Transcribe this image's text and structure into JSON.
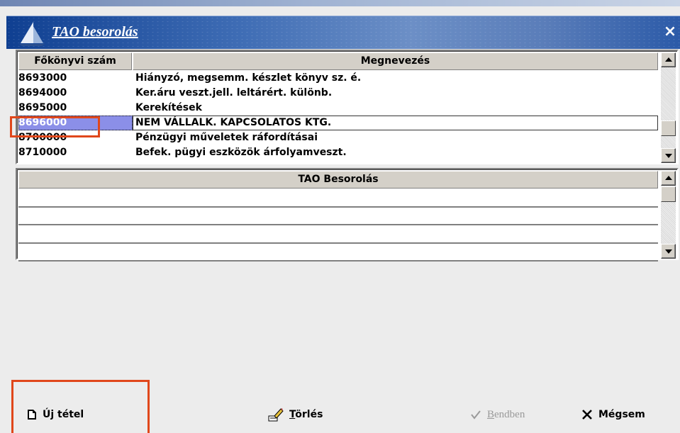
{
  "window": {
    "title": "TAO besorolás",
    "close_glyph": "×"
  },
  "grid_main": {
    "headers": [
      "Főkönyvi szám",
      "Megnevezés"
    ],
    "rows": [
      {
        "code": "8693000",
        "name": "Hiányzó, megsemm. készlet könyv sz. é."
      },
      {
        "code": "8694000",
        "name": "Ker.áru veszt.jell. leltárért. különb."
      },
      {
        "code": "8695000",
        "name": "Kerekítések"
      },
      {
        "code": "8696000",
        "name": "NEM VÁLLALK. KAPCSOLATOS KTG.",
        "selected": true
      },
      {
        "code": "8700000",
        "name": "Pénzügyi műveletek ráfordításai"
      },
      {
        "code": "8710000",
        "name": "Befek. pügyi eszközök árfolyamveszt."
      }
    ]
  },
  "grid_tao": {
    "header": "TAO Besorolás",
    "empty_rows": 4
  },
  "toolbar": {
    "new_label": "Új tétel",
    "delete_prefix": "T",
    "delete_rest": "örlés",
    "ok_prefix": "B",
    "ok_rest": "endben",
    "cancel_label": "Mégsem"
  },
  "colors": {
    "selection": "#8b8fe8",
    "highlight": "#e0471b",
    "titlebar": "#1f4fa0",
    "disabled": "#9a9a9a"
  },
  "icons": {
    "new": "document-icon",
    "delete": "pencil-eraser-icon",
    "ok": "checkmark-icon",
    "cancel": "x-icon",
    "app": "sail-logo-icon"
  }
}
